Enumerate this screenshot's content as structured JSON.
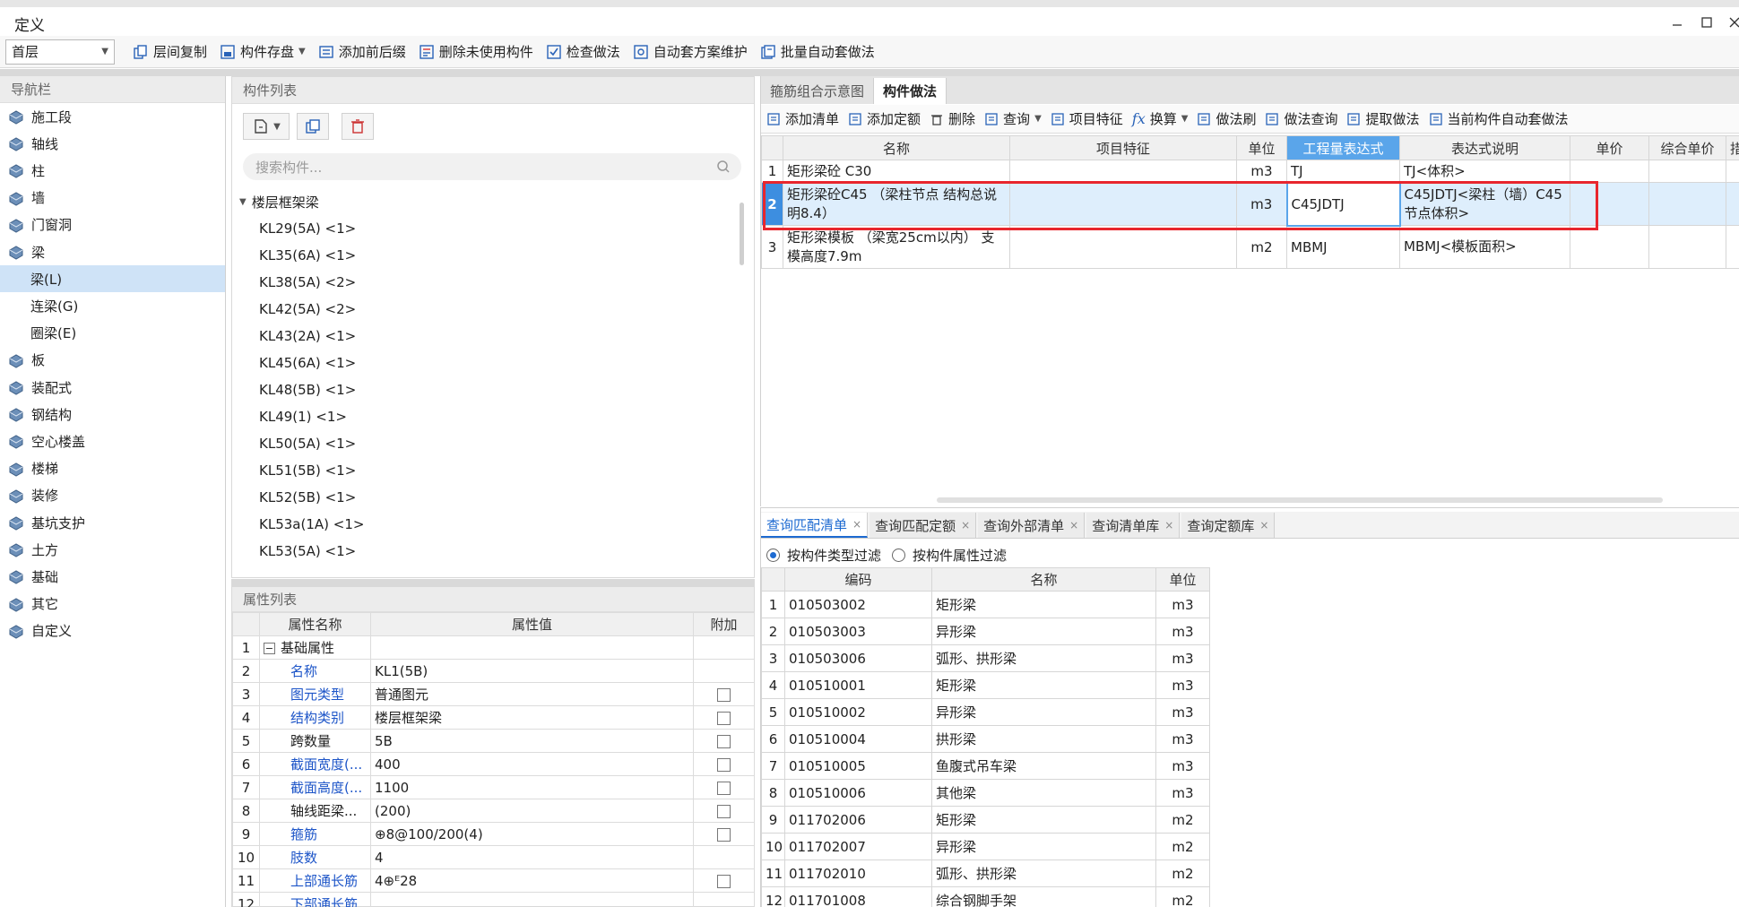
{
  "window": {
    "title": "定义",
    "controls": [
      "minimize-icon",
      "maximize-icon",
      "close-icon"
    ]
  },
  "toolbar": {
    "floor": "首层",
    "buttons": [
      "层间复制",
      "构件存盘",
      "添加前后缀",
      "删除未使用构件",
      "检查做法",
      "自动套方案维护",
      "批量自动套做法"
    ]
  },
  "nav": {
    "header": "导航栏",
    "items": [
      {
        "label": "施工段",
        "icon": "segment-icon"
      },
      {
        "label": "轴线",
        "icon": "grid-icon"
      },
      {
        "label": "柱",
        "icon": "column-icon"
      },
      {
        "label": "墙",
        "icon": "wall-icon"
      },
      {
        "label": "门窗洞",
        "icon": "door-window-icon"
      },
      {
        "label": "梁",
        "icon": "beam-icon"
      },
      {
        "label": "梁(L)",
        "sub": true,
        "selected": true
      },
      {
        "label": "连梁(G)",
        "sub": true
      },
      {
        "label": "圈梁(E)",
        "sub": true
      },
      {
        "label": "板",
        "icon": "slab-icon"
      },
      {
        "label": "装配式",
        "icon": "prefab-icon"
      },
      {
        "label": "钢结构",
        "icon": "steel-icon"
      },
      {
        "label": "空心楼盖",
        "icon": "hollow-floor-icon"
      },
      {
        "label": "楼梯",
        "icon": "stair-icon"
      },
      {
        "label": "装修",
        "icon": "decoration-icon"
      },
      {
        "label": "基坑支护",
        "icon": "pit-support-icon"
      },
      {
        "label": "土方",
        "icon": "earthwork-icon"
      },
      {
        "label": "基础",
        "icon": "foundation-icon"
      },
      {
        "label": "其它",
        "icon": "other-icon"
      },
      {
        "label": "自定义",
        "icon": "custom-icon"
      }
    ]
  },
  "component_list": {
    "header": "构件列表",
    "search_placeholder": "搜索构件...",
    "group": "楼层框架梁",
    "items": [
      "KL29(5A) <1>",
      "KL35(6A) <1>",
      "KL38(5A) <2>",
      "KL42(5A) <2>",
      "KL43(2A) <1>",
      "KL45(6A) <1>",
      "KL48(5B) <1>",
      "KL49(1) <1>",
      "KL50(5A) <1>",
      "KL51(5B) <1>",
      "KL52(5B) <1>",
      "KL53a(1A) <1>",
      "KL53(5A) <1>"
    ]
  },
  "property_list": {
    "header": "属性列表",
    "columns": [
      "属性名称",
      "属性值",
      "附加"
    ],
    "rows": [
      {
        "n": "1",
        "name": "基础属性",
        "value": "",
        "group": true,
        "check": false
      },
      {
        "n": "2",
        "name": "名称",
        "value": "KL1(5B)",
        "blue": true,
        "check": false
      },
      {
        "n": "3",
        "name": "图元类型",
        "value": "普通图元",
        "blue": true,
        "check": true
      },
      {
        "n": "4",
        "name": "结构类别",
        "value": "楼层框架梁",
        "blue": true,
        "check": true
      },
      {
        "n": "5",
        "name": "跨数量",
        "value": "5B",
        "blue": false,
        "check": true
      },
      {
        "n": "6",
        "name": "截面宽度(...",
        "value": "400",
        "blue": true,
        "check": true
      },
      {
        "n": "7",
        "name": "截面高度(...",
        "value": "1100",
        "blue": true,
        "check": true
      },
      {
        "n": "8",
        "name": "轴线距梁...",
        "value": "(200)",
        "blue": false,
        "check": true
      },
      {
        "n": "9",
        "name": "箍筋",
        "value": "⊕8@100/200(4)",
        "blue": true,
        "check": true
      },
      {
        "n": "10",
        "name": "肢数",
        "value": "4",
        "blue": true,
        "check": false
      },
      {
        "n": "11",
        "name": "上部通长筋",
        "value": "4⊕ᴱ28",
        "blue": true,
        "check": true
      },
      {
        "n": "12",
        "name": "下部通长筋",
        "value": "",
        "blue": true,
        "check": false
      }
    ]
  },
  "method_panel": {
    "tabs": [
      "箍筋组合示意图",
      "构件做法"
    ],
    "active_tab": 1,
    "toolbar": [
      "添加清单",
      "添加定额",
      "删除",
      "查询",
      "项目特征",
      "换算",
      "做法刷",
      "做法查询",
      "提取做法",
      "当前构件自动套做法"
    ],
    "columns": [
      "",
      "名称",
      "项目特征",
      "单位",
      "工程量表达式",
      "表达式说明",
      "单价",
      "综合单价",
      "措"
    ],
    "rows": [
      {
        "n": "1",
        "name": "矩形梁砼 C30",
        "feature": "",
        "unit": "m3",
        "expr": "TJ",
        "desc": "TJ<体积>"
      },
      {
        "n": "2",
        "name": "矩形梁砼C45 （梁柱节点 结构总说明8.4）",
        "feature": "",
        "unit": "m3",
        "expr": "C45JDTJ",
        "desc": "C45JDTJ<梁柱（墙）C45节点体积>"
      },
      {
        "n": "3",
        "name": "矩形梁模板 （梁宽25cm以内） 支模高度7.9m",
        "feature": "",
        "unit": "m2",
        "expr": "MBMJ",
        "desc": "MBMJ<模板面积>"
      }
    ]
  },
  "query_panel": {
    "tabs": [
      "查询匹配清单",
      "查询匹配定额",
      "查询外部清单",
      "查询清单库",
      "查询定额库"
    ],
    "active_tab": 0,
    "filters": [
      "按构件类型过滤",
      "按构件属性过滤"
    ],
    "active_filter": 0,
    "columns": [
      "",
      "编码",
      "名称",
      "单位"
    ],
    "rows": [
      {
        "n": "1",
        "code": "010503002",
        "name": "矩形梁",
        "unit": "m3"
      },
      {
        "n": "2",
        "code": "010503003",
        "name": "异形梁",
        "unit": "m3"
      },
      {
        "n": "3",
        "code": "010503006",
        "name": "弧形、拱形梁",
        "unit": "m3"
      },
      {
        "n": "4",
        "code": "010510001",
        "name": "矩形梁",
        "unit": "m3"
      },
      {
        "n": "5",
        "code": "010510002",
        "name": "异形梁",
        "unit": "m3"
      },
      {
        "n": "6",
        "code": "010510004",
        "name": "拱形梁",
        "unit": "m3"
      },
      {
        "n": "7",
        "code": "010510005",
        "name": "鱼腹式吊车梁",
        "unit": "m3"
      },
      {
        "n": "8",
        "code": "010510006",
        "name": "其他梁",
        "unit": "m3"
      },
      {
        "n": "9",
        "code": "011702006",
        "name": "矩形梁",
        "unit": "m2"
      },
      {
        "n": "10",
        "code": "011702007",
        "name": "异形梁",
        "unit": "m2"
      },
      {
        "n": "11",
        "code": "011702010",
        "name": "弧形、拱形梁",
        "unit": "m2"
      },
      {
        "n": "12",
        "code": "011701008",
        "name": "综合钢脚手架",
        "unit": "m2"
      }
    ]
  },
  "colors": {
    "accent": "#1d6ad1",
    "selected_row": "#deeefc",
    "header_highlight": "#5aa5ea",
    "annotation_red": "#e8262d"
  }
}
